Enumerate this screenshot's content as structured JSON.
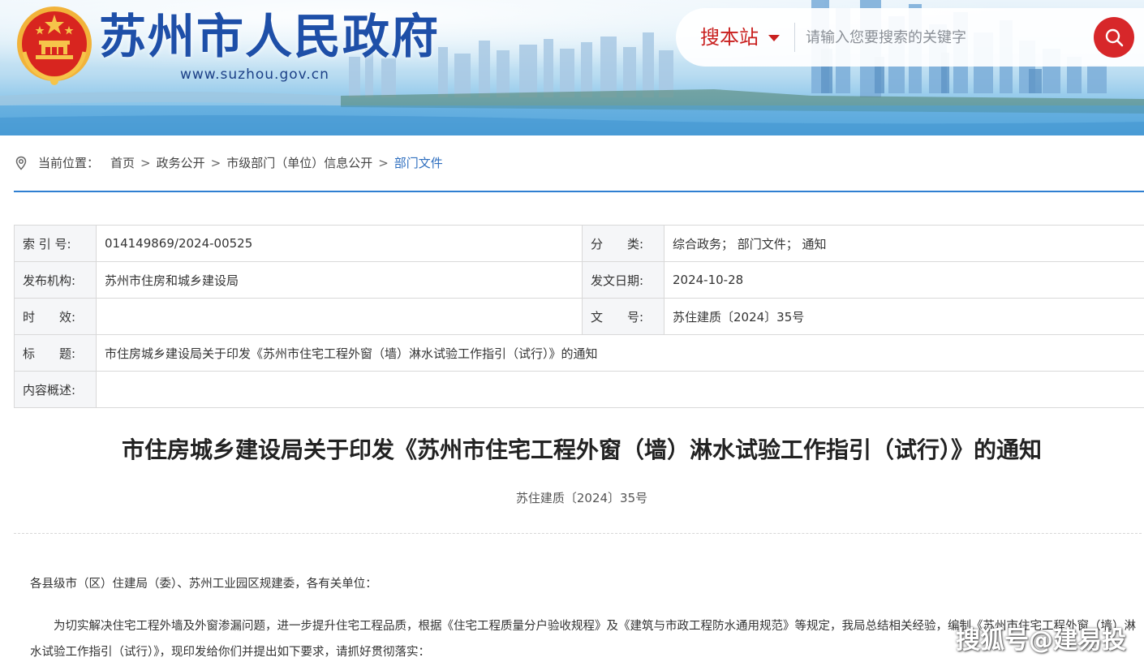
{
  "header": {
    "site_title": "苏州市人民政府",
    "site_url": "www.suzhou.gov.cn",
    "search_scope": "搜本站",
    "search_placeholder": "请输入您要搜索的关键字"
  },
  "breadcrumb": {
    "prefix": "当前位置：",
    "items": [
      "首页",
      "政务公开",
      "市级部门（单位）信息公开",
      "部门文件"
    ],
    "separator": ">"
  },
  "meta": {
    "index_label": "索 引 号:",
    "index_value": "014149869/2024-00525",
    "category_label": "分　　类:",
    "category_value": "综合政务；  部门文件；  通知",
    "publisher_label": "发布机构:",
    "publisher_value": "苏州市住房和城乡建设局",
    "date_label": "发文日期:",
    "date_value": "2024-10-28",
    "validity_label": "时　　效:",
    "validity_value": "",
    "docno_label": "文　　号:",
    "docno_value": "苏住建质〔2024〕35号",
    "title_label": "标　　题:",
    "title_value": "市住房城乡建设局关于印发《苏州市住宅工程外窗（墙）淋水试验工作指引（试行）》的通知",
    "summary_label": "内容概述:",
    "summary_value": ""
  },
  "article": {
    "title": "市住房城乡建设局关于印发《苏州市住宅工程外窗（墙）淋水试验工作指引（试行）》的通知",
    "doc_number": "苏住建质〔2024〕35号",
    "salutation": "各县级市（区）住建局（委）、苏州工业园区规建委，各有关单位：",
    "body_1": "为切实解决住宅工程外墙及外窗渗漏问题，进一步提升住宅工程品质，根据《住宅工程质量分户验收规程》及《建筑与市政工程防水通用规范》等规定，我局总结相关经验，编制《苏州市住宅工程外窗（墙）淋水试验工作指引（试行）》，现印发给你们并提出如下要求，请抓好贯彻落实："
  },
  "watermark": "搜狐号@建易投",
  "colors": {
    "brand_blue": "#1e4fa8",
    "search_red": "#d7272a",
    "link_blue": "#2f6fbf",
    "rule_blue": "#2f7fd1"
  },
  "icons": [
    "national-emblem-icon",
    "chevron-down-icon",
    "search-icon",
    "location-pin-icon"
  ]
}
